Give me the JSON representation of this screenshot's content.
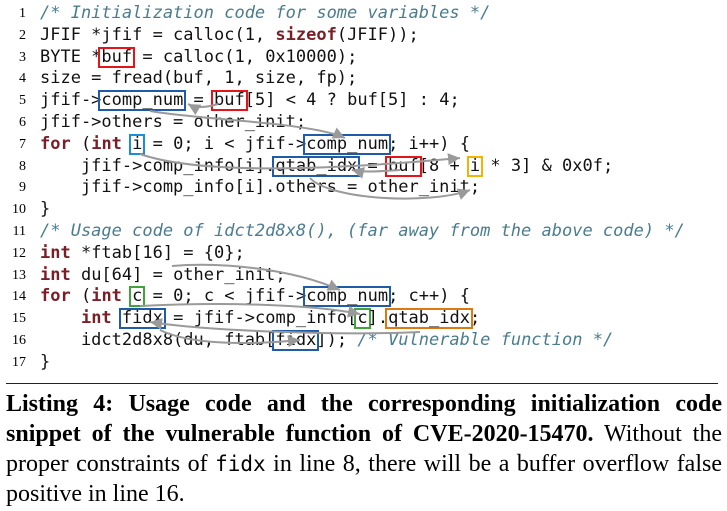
{
  "listing": {
    "lines": [
      {
        "num": "1",
        "parts": [
          {
            "t": "/* Initialization code for some variables */",
            "c": "cm"
          }
        ]
      },
      {
        "num": "2",
        "parts": [
          {
            "t": "JFIF *jfif = calloc(1, "
          },
          {
            "t": "sizeof",
            "c": "kw"
          },
          {
            "t": "(JFIF));"
          }
        ]
      },
      {
        "num": "3",
        "parts": [
          {
            "t": "BYTE *"
          },
          {
            "t": "buf",
            "box": "red"
          },
          {
            "t": " = calloc(1, 0x10000);"
          }
        ]
      },
      {
        "num": "4",
        "parts": [
          {
            "t": "size = fread(buf, 1, size, fp);"
          }
        ]
      },
      {
        "num": "5",
        "parts": [
          {
            "t": "jfif->"
          },
          {
            "t": "comp_num",
            "box": "blue"
          },
          {
            "t": " = "
          },
          {
            "t": "buf",
            "box": "red"
          },
          {
            "t": "[5] < 4 ? buf[5] : 4;"
          }
        ]
      },
      {
        "num": "6",
        "parts": [
          {
            "t": "jfif->others = other_init;"
          }
        ]
      },
      {
        "num": "7",
        "parts": [
          {
            "t": "for",
            "c": "kw"
          },
          {
            "t": " ("
          },
          {
            "t": "int",
            "c": "kw"
          },
          {
            "t": " "
          },
          {
            "t": "i",
            "box": "lblue"
          },
          {
            "t": " = 0; i < jfif->"
          },
          {
            "t": "comp_num",
            "box": "blue"
          },
          {
            "t": "; i++) {"
          }
        ]
      },
      {
        "num": "8",
        "parts": [
          {
            "t": "    jfif->comp_info[i]."
          },
          {
            "t": "qtab_idx",
            "box": "blue"
          },
          {
            "t": " = "
          },
          {
            "t": "buf",
            "box": "red"
          },
          {
            "t": "[8 + "
          },
          {
            "t": "i",
            "box": "yellow"
          },
          {
            "t": " * 3] & 0x0f;"
          }
        ]
      },
      {
        "num": "9",
        "parts": [
          {
            "t": "    jfif->comp_info[i].others = other_init;"
          }
        ]
      },
      {
        "num": "10",
        "parts": [
          {
            "t": "}"
          }
        ]
      },
      {
        "num": "11",
        "parts": [
          {
            "t": "/* Usage code of idct2d8x8(), (far away from the above code) */",
            "c": "cm"
          }
        ]
      },
      {
        "num": "12",
        "parts": [
          {
            "t": "int",
            "c": "kw"
          },
          {
            "t": " *ftab[16] = {0};"
          }
        ]
      },
      {
        "num": "13",
        "parts": [
          {
            "t": "int",
            "c": "kw"
          },
          {
            "t": " du[64] = other_init;"
          }
        ]
      },
      {
        "num": "14",
        "parts": [
          {
            "t": "for",
            "c": "kw"
          },
          {
            "t": " ("
          },
          {
            "t": "int",
            "c": "kw"
          },
          {
            "t": " "
          },
          {
            "t": "c",
            "box": "green"
          },
          {
            "t": " = 0; c < jfif->"
          },
          {
            "t": "comp_num",
            "box": "blue"
          },
          {
            "t": "; c++) {"
          }
        ]
      },
      {
        "num": "15",
        "parts": [
          {
            "t": "    "
          },
          {
            "t": "int",
            "c": "kw"
          },
          {
            "t": " "
          },
          {
            "t": "fidx",
            "box": "blue"
          },
          {
            "t": " = jfif->comp_info["
          },
          {
            "t": "c",
            "box": "green"
          },
          {
            "t": "]."
          },
          {
            "t": "qtab_idx",
            "box": "orange"
          },
          {
            "t": ";"
          }
        ]
      },
      {
        "num": "16",
        "parts": [
          {
            "t": "    idct2d8x8(du, ftab["
          },
          {
            "t": "fidx",
            "box": "blue"
          },
          {
            "t": "]); "
          },
          {
            "t": "/* Vulnerable function */",
            "c": "cm"
          }
        ]
      },
      {
        "num": "17",
        "parts": [
          {
            "t": "}"
          }
        ]
      }
    ]
  },
  "caption": {
    "bold_text": "Listing 4: Usage code and the corresponding initialization code snippet of the vulnerable function of CVE-2020-15470.",
    "normal_text_1": " Without the proper constraints of ",
    "mono_text": "fidx",
    "normal_text_2": " in line 8, there will be a buffer overflow false positive in line 16."
  },
  "colors": {
    "red": "#e3141a",
    "blue": "#1f5ca8",
    "lblue": "#1c8fd2",
    "yellow": "#f2b400",
    "green": "#41a43a",
    "orange": "#e07810",
    "comment": "#4a7c8f",
    "keyword": "#7a1f26",
    "arrow": "#9a9a9a"
  }
}
